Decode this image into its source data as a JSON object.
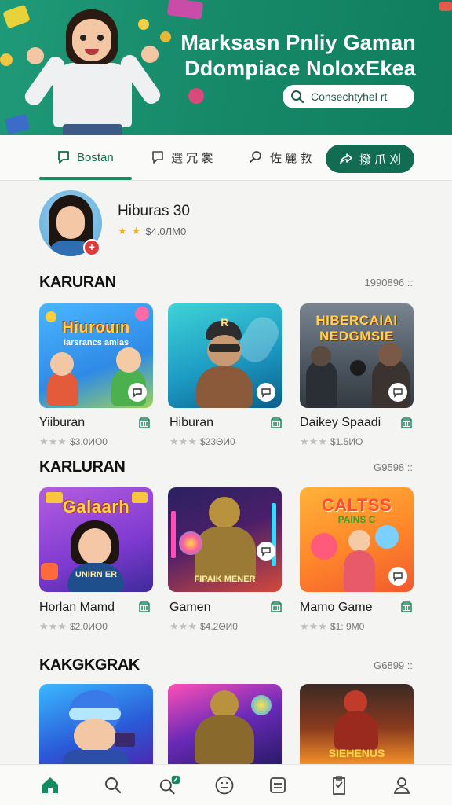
{
  "banner": {
    "title_line1": "Marksasn Pnliy Gaman",
    "title_line2": "Ddompiace NoloxEkea",
    "search_label": "Consechtyhel rt"
  },
  "tabs": [
    {
      "label": "Bostan",
      "icon": "chat-square-icon",
      "active": true
    },
    {
      "label": "選 冗 裳",
      "icon": "square-bubble-icon",
      "active": false
    },
    {
      "label": "佐 麗 救",
      "icon": "magnifier-icon",
      "active": false
    }
  ],
  "tab_button": {
    "label": "撥 爪 刈",
    "icon": "share-icon"
  },
  "profile": {
    "name": "Hiburas 30",
    "rating_stars": 2,
    "price": "$4.0ЛМ0"
  },
  "sections": [
    {
      "title": "KARURAN",
      "more": "1990896 ::",
      "games": [
        {
          "name": "Yiiburan",
          "price": "$3.0ИО0",
          "card_title": "Hiurouın",
          "card_sub": "Iarsrancs amlas"
        },
        {
          "name": "Hiburan",
          "price": "$23ΘИ0",
          "card_title": "R",
          "card_sub": ""
        },
        {
          "name": "Daikey Spaadi",
          "price": "$1.5ИО",
          "card_title": "HIBERCAIAI",
          "card_sub": "NEDGMSIE"
        }
      ]
    },
    {
      "title": "KARLURAN",
      "more": "G9598 ::",
      "games": [
        {
          "name": "Horlan Mamd",
          "price": "$2.0ИО0",
          "card_title": "Galaarh",
          "card_sub": "UNIRN ER"
        },
        {
          "name": "Gamen",
          "price": "$4.2ΘИ0",
          "card_title": "",
          "card_sub": "FIPAIK MENER"
        },
        {
          "name": "Mamo Game",
          "price": "$1: 9M0",
          "card_title": "CALTSS",
          "card_sub": "PAINS C"
        }
      ]
    },
    {
      "title": "KAKGKGRAK",
      "more": "G6899 ::",
      "games": [
        {
          "name": "",
          "price": "",
          "card_title": "",
          "card_sub": ""
        },
        {
          "name": "",
          "price": "",
          "card_title": "",
          "card_sub": ""
        },
        {
          "name": "",
          "price": "",
          "card_title": "",
          "card_sub": "SIEHENUS"
        }
      ]
    }
  ],
  "bottom_nav": [
    {
      "icon": "home-icon",
      "active": true
    },
    {
      "icon": "search-icon"
    },
    {
      "icon": "search-badge-icon"
    },
    {
      "icon": "face-icon"
    },
    {
      "icon": "list-icon"
    },
    {
      "icon": "clipboard-icon"
    },
    {
      "icon": "profile-icon"
    }
  ],
  "colors": {
    "brand": "#126c52",
    "accent": "#1b8a65",
    "star": "#f2b31b"
  }
}
